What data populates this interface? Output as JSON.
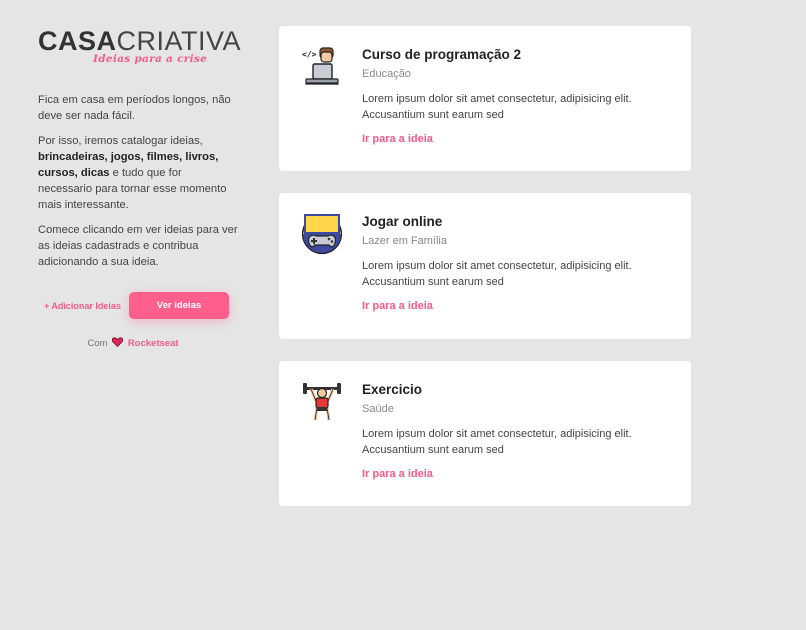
{
  "brand": {
    "logo_main_bold": "CASA",
    "logo_main_light": "CRIATIVA",
    "logo_sub": "Ideias para a crise",
    "accent_color": "#f55b89"
  },
  "sidebar": {
    "p1": "Fica em casa em períodos longos, não deve ser nada fácil.",
    "p2_prefix": "Por isso, iremos catalogar ideias, ",
    "p2_bold": "brincadeiras, jogos, filmes, livros, cursos, dicas",
    "p2_suffix": " e tudo que for necessario para tornar esse momento mais interessante.",
    "p3": "Comece clicando em ver ideias para ver as ideias cadastrads e contribua adicionando a sua ideia.",
    "add_label": "+ Adicionar Ideias",
    "view_label": "Ver ideias",
    "credit_prefix": "Com",
    "credit_brand": "Rocketseat"
  },
  "cards": [
    {
      "title": "Curso de programação 2",
      "category": "Educação",
      "text": "Lorem ipsum dolor sit amet consectetur, adipisicing elit. Accusantium sunt earum sed",
      "link": "Ir para a ideia",
      "icon": "programmer-icon"
    },
    {
      "title": "Jogar online",
      "category": "Lazer em Família",
      "text": "Lorem ipsum dolor sit amet consectetur, adipisicing elit. Accusantium sunt earum sed",
      "link": "Ir para a ideia",
      "icon": "gamepad-icon"
    },
    {
      "title": "Exercicio",
      "category": "Saúde",
      "text": "Lorem ipsum dolor sit amet consectetur, adipisicing elit. Accusantium sunt earum sed",
      "link": "Ir para a ideia",
      "icon": "weightlifter-icon"
    }
  ]
}
